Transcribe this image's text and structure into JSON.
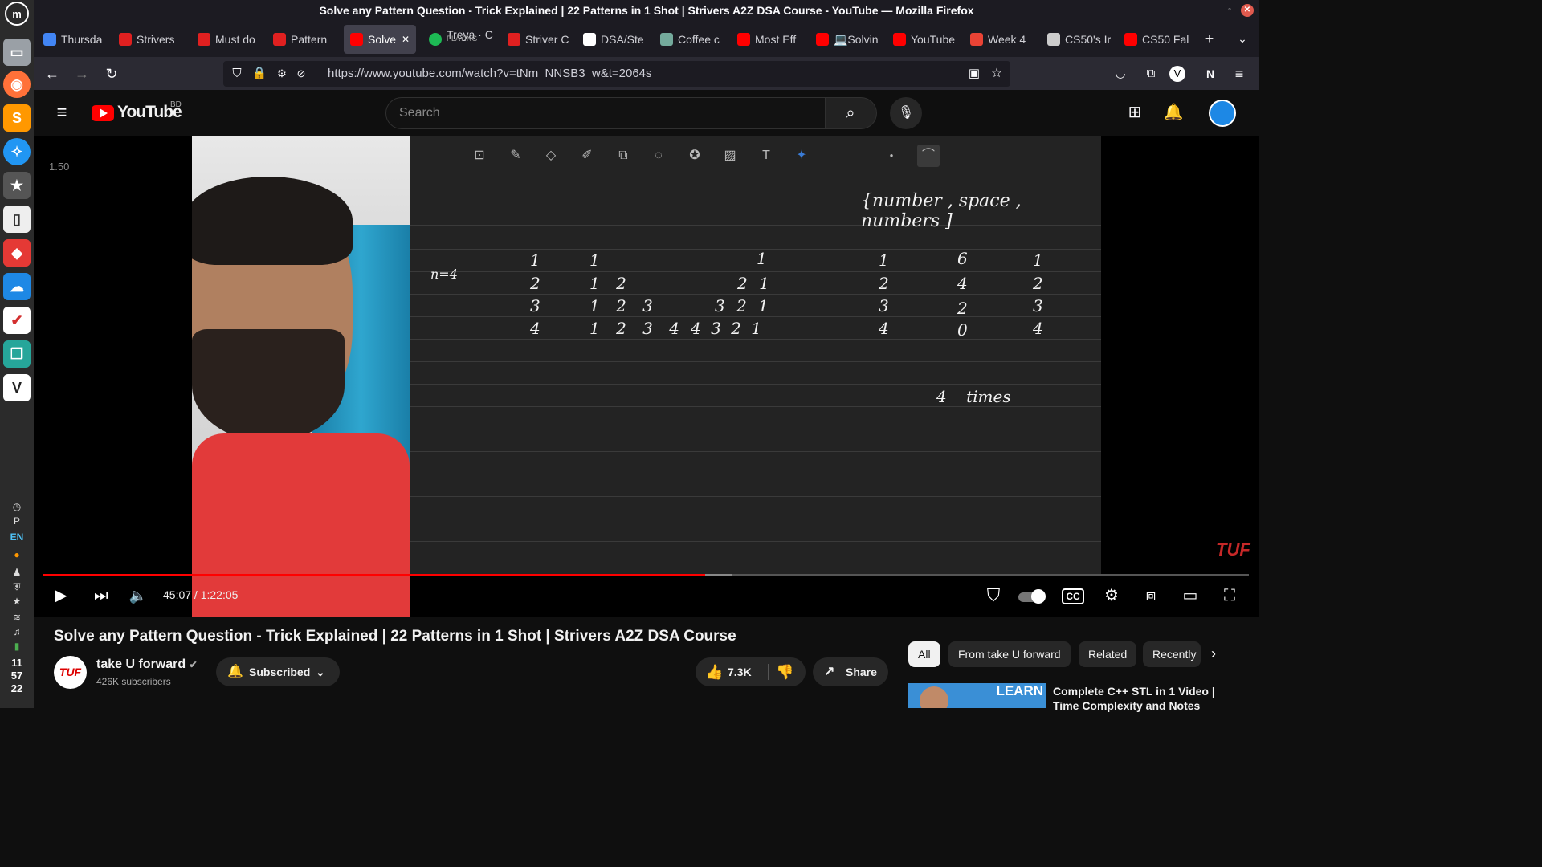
{
  "window": {
    "title": "Solve any Pattern Question - Trick Explained | 22 Patterns in 1 Shot | Strivers A2Z DSA Course - YouTube — Mozilla Firefox"
  },
  "tabs": [
    {
      "label": "Thursda",
      "icon": "chart-icon",
      "color": "#4285f4"
    },
    {
      "label": "Strivers",
      "icon": "tuf-icon",
      "color": "#e02020"
    },
    {
      "label": "Must do",
      "icon": "tuf-icon",
      "color": "#e02020"
    },
    {
      "label": "Pattern",
      "icon": "tuf-icon",
      "color": "#e02020"
    },
    {
      "label": "Solve",
      "icon": "youtube-icon",
      "color": "#ff0000",
      "active": true
    },
    {
      "label": "Treya · C",
      "sub": "PLAYING",
      "icon": "spotify-icon",
      "color": "#1db954"
    },
    {
      "label": "Striver C",
      "icon": "tuf-icon",
      "color": "#e02020"
    },
    {
      "label": "DSA/Ste",
      "icon": "github-icon",
      "color": "#ffffff"
    },
    {
      "label": "Coffee c",
      "icon": "chatgpt-icon",
      "color": "#74aa9c"
    },
    {
      "label": "Most Eff",
      "icon": "youtube-icon",
      "color": "#ff0000"
    },
    {
      "label": "💻Solvin",
      "icon": "youtube-icon",
      "color": "#ff0000"
    },
    {
      "label": "YouTube",
      "icon": "youtube-icon",
      "color": "#ff0000"
    },
    {
      "label": "Week 4",
      "icon": "gmail-icon",
      "color": "#ea4335"
    },
    {
      "label": "CS50's Ir",
      "icon": "edx-icon",
      "color": "#cccccc"
    },
    {
      "label": "CS50 Fal",
      "icon": "youtube-icon",
      "color": "#ff0000"
    }
  ],
  "nav": {
    "url": "https://www.youtube.com/watch?v=tNm_NNSB3_w&t=2064s"
  },
  "youtube": {
    "logo_text": "YouTube",
    "country": "BD",
    "search_placeholder": "Search"
  },
  "player": {
    "speed_overlay": "1.50",
    "current_time": "45:07",
    "duration": "1:22:05",
    "time_display": "45:07 / 1:22:05",
    "progress_fraction": 0.549,
    "watermark": "TUF"
  },
  "board": {
    "header_note": "{number , space , numbers ]",
    "n_label": "n=4",
    "col1": [
      "1",
      "2",
      "3",
      "4"
    ],
    "col2": [
      "1",
      "1 2",
      "1 2 3",
      "1 2 3 4"
    ],
    "col3": [
      "1",
      "2 1",
      "3 2 1",
      "4 3 2 1"
    ],
    "col4": [
      "1",
      "2",
      "3",
      "4"
    ],
    "col5": [
      "6",
      "4",
      "2",
      "0"
    ],
    "col6": [
      "1",
      "2",
      "3",
      "4"
    ],
    "times_note": "4 times"
  },
  "video": {
    "title": "Solve any Pattern Question - Trick Explained | 22 Patterns in 1 Shot | Strivers A2Z DSA Course",
    "channel": "take U forward",
    "channel_logo": "TUF",
    "subscribers": "426K subscribers",
    "subscribe_label": "Subscribed",
    "likes": "7.3K",
    "share_label": "Share"
  },
  "chips": [
    "All",
    "From take U forward",
    "Related",
    "Recently"
  ],
  "recommendation": {
    "title": "Complete C++ STL in 1 Video | Time Complexity and Notes",
    "thumb_text": "LEARN"
  },
  "tray": {
    "lang": "EN",
    "clock": [
      "11",
      "57",
      "22"
    ]
  }
}
